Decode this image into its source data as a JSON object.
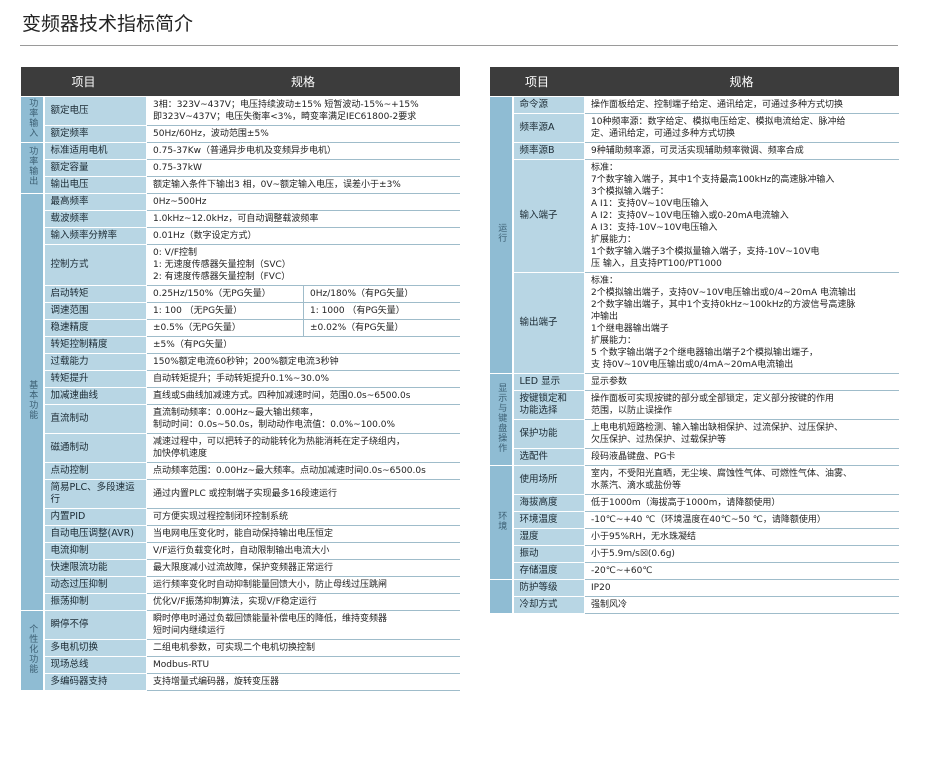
{
  "title": "变频器技术指标简介",
  "left": {
    "header": {
      "item": "项目",
      "spec": "规格"
    },
    "groups": [
      {
        "name": "功率输入",
        "rows": [
          {
            "item": "额定电压",
            "value": "3相：323V~437V；电压持续波动±15%  短暂波动-15%~+15%\n即323V~437V；电压失衡率<3%，畸变率满足IEC61800-2要求"
          },
          {
            "item": "额定频率",
            "value": "50Hz/60Hz，波动范围±5%"
          }
        ]
      },
      {
        "name": "功率输出",
        "rows": [
          {
            "item": "标准适用电机",
            "value": "0.75-37Kw（普通异步电机及变频异步电机）"
          },
          {
            "item": "额定容量",
            "value": "0.75-37kW"
          },
          {
            "item": "输出电压",
            "value": "额定输入条件下输出3 相，0V~额定输入电压，误差小于±3%"
          }
        ]
      },
      {
        "name": "基本功能",
        "rows": [
          {
            "item": "最高频率",
            "value": "0Hz~500Hz"
          },
          {
            "item": "载波频率",
            "value": "1.0kHz~12.0kHz，可自动调整载波频率"
          },
          {
            "item": "输入频率分辨率",
            "value": "0.01Hz（数字设定方式）"
          },
          {
            "item": "控制方式",
            "value": "0: V/F控制\n1: 无速度传感器矢量控制（SVC）\n2: 有速度传感器矢量控制（FVC）"
          },
          {
            "item": "启动转矩",
            "value": "0.25Hz/150%（无PG矢量）",
            "value2": "0Hz/180%（有PG矢量）"
          },
          {
            "item": "调速范围",
            "value": "1: 100 （无PG矢量）",
            "value2": "1: 1000 （有PG矢量）"
          },
          {
            "item": "稳速精度",
            "value": "±0.5%（无PG矢量）",
            "value2": "±0.02%（有PG矢量）"
          },
          {
            "item": "转矩控制精度",
            "value": "±5%（有PG矢量）"
          },
          {
            "item": "过载能力",
            "value": "150%额定电流60秒钟；200%额定电流3秒钟"
          },
          {
            "item": "转矩提升",
            "value": "自动转矩提升；手动转矩提升0.1%~30.0%"
          },
          {
            "item": "加减速曲线",
            "value": "直线或S曲线加减速方式。四种加减速时间，范围0.0s~6500.0s"
          },
          {
            "item": "直流制动",
            "value": "直流制动频率：0.00Hz~最大输出频率，\n制动时间：0.0s~50.0s，制动动作电流值：0.0%~100.0%"
          },
          {
            "item": "磁通制动",
            "value": "减速过程中，可以把转子的动能转化为热能消耗在定子绕组内，\n加快停机速度"
          },
          {
            "item": "点动控制",
            "value": "点动频率范围：0.00Hz~最大频率。点动加减速时间0.0s~6500.0s"
          },
          {
            "item": "简易PLC、多段速运行",
            "value": "通过内置PLC 或控制端子实现最多16段速运行"
          },
          {
            "item": "内置PID",
            "value": "可方便实现过程控制闭环控制系统"
          },
          {
            "item": "自动电压调整(AVR)",
            "value": "当电网电压变化时，能自动保持输出电压恒定"
          },
          {
            "item": "电流抑制",
            "value": "V/F运行负载变化时，自动限制输出电流大小"
          },
          {
            "item": "快速限流功能",
            "value": "最大限度减小过流故障，保护变频器正常运行"
          },
          {
            "item": "动态过压抑制",
            "value": "运行频率变化时自动抑制能量回馈大小，防止母线过压跳闸"
          },
          {
            "item": "振荡抑制",
            "value": "优化V/F振荡抑制算法，实现V/F稳定运行"
          }
        ]
      },
      {
        "name": "个性化功能",
        "rows": [
          {
            "item": "瞬停不停",
            "value": "瞬时停电时通过负载回馈能量补偿电压的降低，维持变频器\n短时间内继续运行"
          },
          {
            "item": "多电机切换",
            "value": "二组电机参数，可实现二个电机切换控制"
          },
          {
            "item": "现场总线",
            "value": "Modbus-RTU"
          },
          {
            "item": "多编码器支持",
            "value": "支持增量式编码器，旋转变压器"
          }
        ]
      }
    ]
  },
  "right": {
    "header": {
      "item": "项目",
      "spec": "规格"
    },
    "groups": [
      {
        "name": "运行",
        "rows": [
          {
            "item": "命令源",
            "value": "操作面板给定、控制端子给定、通讯给定，可通过多种方式切换"
          },
          {
            "item": "频率源A",
            "value": "10种频率源：数字给定、模拟电压给定、模拟电流给定、脉冲给\n定、通讯给定，可通过多种方式切换"
          },
          {
            "item": "频率源B",
            "value": "9种辅助频率源，可灵活实现辅助频率微调、频率合成"
          },
          {
            "item": "输入端子",
            "value": "标准：\n7个数字输入端子，其中1个支持最高100kHz的高速脉冲输入\n3个模拟输入端子：\n    A I1：支持0V~10V电压输入\n    A I2：支持0V~10V电压输入或0-20mA电流输入\n    A I3：支持-10V~10V电压输入\n扩展能力：\n  1个数字输入端子3个模拟量输入端子，支持-10V~10V电\n  压 输入，且支持PT100/PT1000"
          },
          {
            "item": "输出端子",
            "value": "标准：\n2个模拟输出端子，支持0V~10V电压输出或0/4~20mA 电流输出\n2个数字输出端子，其中1个支持0kHz~100kHz的方波信号高速脉\n冲输出\n1个继电器输出端子\n扩展能力：\n  5 个数字输出端子2个继电器输出端子2个模拟输出端子，\n  支 持0V~10V电压输出或0/4mA~20mA电流输出"
          }
        ]
      },
      {
        "name": "显示与键盘操作",
        "rows": [
          {
            "item": "LED 显示",
            "value": "显示参数"
          },
          {
            "item": "按键锁定和\n功能选择",
            "value": "操作面板可实现按键的部分或全部锁定，定义部分按键的作用\n范围，以防止误操作"
          },
          {
            "item": "保护功能",
            "value": "上电电机短路检测、输入输出缺相保护、过流保护、过压保护、\n欠压保护、过热保护、过载保护等"
          },
          {
            "item": "选配件",
            "value": "段码液晶键盘、PG卡"
          }
        ]
      },
      {
        "name": "环境",
        "rows": [
          {
            "item": "使用场所",
            "value": "室内，不受阳光直晒，无尘埃、腐蚀性气体、可燃性气体、油雾、\n水蒸汽、滴水或盐份等"
          },
          {
            "item": "海拔高度",
            "value": "低于1000m（海拔高于1000m，请降额使用）"
          },
          {
            "item": "环境温度",
            "value": "-10℃~+40 ℃（环境温度在40℃~50 ℃，请降额使用）"
          },
          {
            "item": "湿度",
            "value": "小于95%RH，无水珠凝结"
          },
          {
            "item": "振动",
            "value": "小于5.9m/s☒(0.6g)"
          },
          {
            "item": "存储温度",
            "value": "-20℃~+60℃"
          }
        ]
      },
      {
        "name": "",
        "rows": [
          {
            "item": "防护等级",
            "value": "IP20"
          },
          {
            "item": "冷却方式",
            "value": "强制风冷"
          }
        ]
      }
    ]
  }
}
